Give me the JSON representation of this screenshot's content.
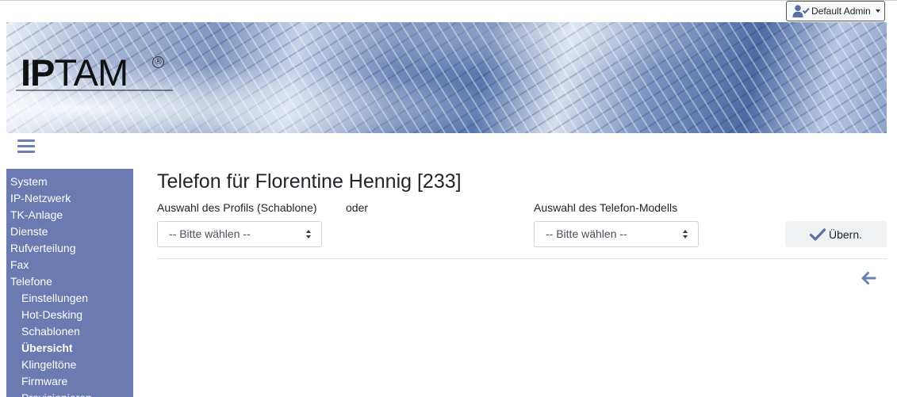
{
  "header": {
    "user_button_label": "Default Admin",
    "user_icon": "user-check-icon",
    "logo_text_bold": "IP",
    "logo_text_light": "TAM",
    "logo_mark": "®"
  },
  "sidebar": {
    "items": [
      {
        "label": "System",
        "level": 1
      },
      {
        "label": "IP-Netzwerk",
        "level": 1
      },
      {
        "label": "TK-Anlage",
        "level": 1
      },
      {
        "label": "Dienste",
        "level": 1
      },
      {
        "label": "Rufverteilung",
        "level": 1
      },
      {
        "label": "Fax",
        "level": 1
      },
      {
        "label": "Telefone",
        "level": 1
      },
      {
        "label": "Einstellungen",
        "level": 2
      },
      {
        "label": "Hot-Desking",
        "level": 2
      },
      {
        "label": "Schablonen",
        "level": 2
      },
      {
        "label": "Übersicht",
        "level": 2,
        "active": true
      },
      {
        "label": "Klingeltöne",
        "level": 2
      },
      {
        "label": "Firmware",
        "level": 2
      },
      {
        "label": "Provisionieren",
        "level": 2
      }
    ]
  },
  "main": {
    "title": "Telefon für Florentine Hennig [233]",
    "profile_label": "Auswahl des Profils (Schablone)",
    "or_label": "oder",
    "model_label": "Auswahl des Telefon-Modells",
    "profile_select_value": "-- Bitte wählen --",
    "model_select_value": "-- Bitte wählen --",
    "apply_label": "Übern.",
    "apply_icon": "check-icon",
    "back_icon": "arrow-left-icon"
  },
  "colors": {
    "sidebar_bg": "#6b7bb1",
    "accent": "#6d7fae",
    "text": "#212529"
  }
}
